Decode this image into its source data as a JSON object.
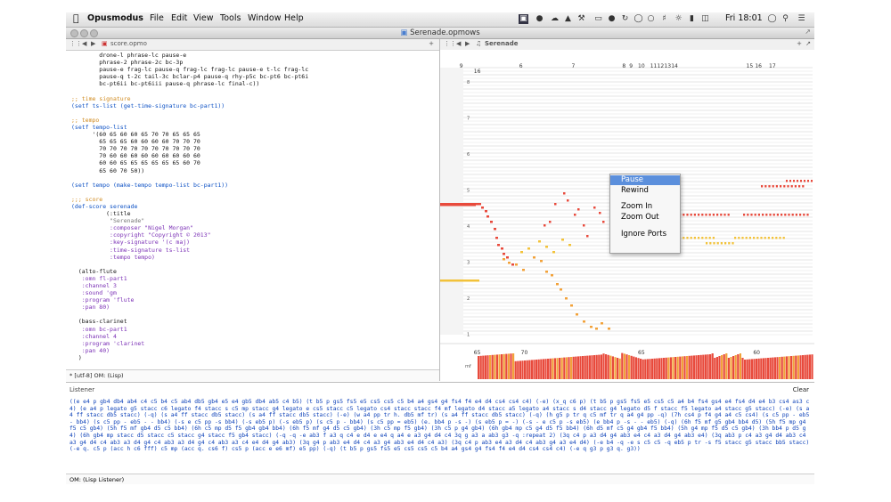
{
  "menubar": {
    "app_name": "Opusmodus",
    "items": [
      "File",
      "Edit",
      "View",
      "Tools",
      "Window",
      "Help"
    ],
    "clock": "Fri 18:01"
  },
  "window": {
    "title": "Serenade.opmows"
  },
  "editor": {
    "tab_title": "score.opmo",
    "code_lines": [
      "        drone-l phrase-lc pause-e",
      "        phrase-2 phrase-2c bc-3p",
      "        pause-e frag-lc pause-q frag-lc frag-lc pause-e t-lc frag-lc",
      "        pause-q t-2c tail-3c bclar-p4 pause-q rhy-p5c bc-pt6 bc-pt6i",
      "        bc-pt6ii bc-pt6iii pause-q phrase-lc final-c))",
      "",
      ";; time signature",
      "(setf ts-list (get-time-signature bc-part1))",
      "",
      ";; tempo",
      "(setf tempo-list",
      "      '(60 65 60 60 65 70 70 65 65 65",
      "        65 65 65 60 60 60 60 70 70 70",
      "        70 70 70 70 70 70 70 70 70 70",
      "        70 60 60 60 60 60 60 60 60 60",
      "        60 60 65 65 65 65 65 65 60 70",
      "        65 60 70 50))",
      "",
      "(setf tempo (make-tempo tempo-list bc-part1))",
      "",
      ";;; score",
      "(def-score serenade",
      "          (:title",
      "           \"Serenade\"",
      "           :composer \"Nigel Morgan\"",
      "           :copyright \"Copyright © 2013\"",
      "           :key-signature '(c maj)",
      "           :time-signature ts-list",
      "           :tempo tempo)",
      "",
      "  (alto-flute",
      "   :omn fl-part1",
      "   :channel 3",
      "   :sound 'gm",
      "   :program 'flute",
      "   :pan 80)",
      "",
      "  (bass-clarinet",
      "   :omn bc-part1",
      "   :channel 4",
      "   :program 'clarinet",
      "   :pan 40)",
      "  )"
    ],
    "status": "* [utf-8] OM:  (Lisp)"
  },
  "roll": {
    "tab_title": "Serenade",
    "bar_numbers": [
      {
        "label": "9",
        "beat": 0.03
      },
      {
        "label": "16",
        "beat": 0.03
      },
      {
        "label": "6",
        "beat": 0.16
      },
      {
        "label": "7",
        "beat": 0.31
      },
      {
        "label": "8",
        "beat": 0.455
      },
      {
        "label": "9",
        "beat": 0.475
      },
      {
        "label": "10",
        "beat": 0.5
      },
      {
        "label": "11",
        "beat": 0.535
      },
      {
        "label": "12",
        "beat": 0.555
      },
      {
        "label": "13",
        "beat": 0.575
      },
      {
        "label": "14",
        "beat": 0.595
      },
      {
        "label": "15",
        "beat": 0.81
      },
      {
        "label": "16",
        "beat": 0.835
      },
      {
        "label": "17",
        "beat": 0.875
      }
    ],
    "octave_labels": [
      "8",
      "7",
      "6",
      "5",
      "4",
      "3",
      "2",
      "1"
    ],
    "tempo_labels": [
      {
        "label": "65",
        "beat": 0.03
      },
      {
        "label": "70",
        "beat": 0.165
      },
      {
        "label": "65",
        "beat": 0.5
      },
      {
        "label": "60",
        "beat": 0.83
      }
    ],
    "velocity_label": "mf"
  },
  "context_menu": {
    "items": [
      "Pause",
      "Rewind",
      "Zoom In",
      "Zoom Out",
      "Ignore Ports"
    ],
    "highlighted": "Pause"
  },
  "listener": {
    "title": "Listener",
    "clear_label": "Clear",
    "output": "((e e4 p gb4 db4 ab4 c4 c5 b4 c5 ab4 db5 gb4 e5 e4 gb5 db4 ab5 c4 b5) (t b5 p gs5 fs5 e5 cs5 cs5 c5 b4 a4 gs4 g4 fs4 f4 e4 d4 cs4 cs4 c4) (-e) (x_q c6 p) (t b5 p gs5 fs5 e5 cs5 c5 a4 b4 fs4 gs4 e4 fs4 d4 e4 b3 cs4 as3 c4) (e a4 p legato g5 stacc c6 legato f4 stacc s c5 mp stacc g4 legato e cs5 stacc c5 legato cs4 stacc stacc f4 mf legato d4 stacc a5 legato a4 stacc s d4 stacc g4 legato d5 f stacc f5 legato a4 stacc g5 stacc) (-e) (s a4 ff stacc db5 stacc) (-q) (s a4 ff stacc db5 stacc) (s a4 ff stacc db5 stacc) (-e) (w a4 pp tr h. db5 mf tr) (s a4 ff stacc db5 stacc) (-q) (h g5 p tr q c5 mf tr q a4 g4 pp -q) (7h cs4 p f4 g4 a4 c5 cs4) (s c5 pp - eb5 - bb4) (s c5 pp - eb5 - - bb4) (-s e c5 pp -s bb4) (-s eb5 p) (-s eb5 p) (s c5 p - bb4) (s c5 pp = eb5) (e. bb4 p -s -) (s eb5 p = -) (-s - e c5 p -s eb5) (e bb4 p -s - - eb5) (-q) (6h f5 mf g5 gb4 bb4 d5) (5h f5 mp g4 f5 c5 gb4) (5h f5 mf gb4 d5 c5 bb4) (6h c5 mp d5 f5 gb4 gb4 bb4) (6h f5 mf g4 d5 c5 gb4) (3h c5 mp f5 gb4) (3h c5 p g4 gb4) (6h gb4 mp c5 g4 d5 f5 bb4) (6h d5 mf c5 g4 gb4 f5 bb4) (5h g4 mp f5 d5 c5 gb4) (3h bb4 p d5 g4) (6h gb4 mp stacc d5 stacc c5 stacc g4 stacc f5 gb4 stacc) (-q -q -e ab3 f a3 q c4 e d4 e e4 q a4 e a3 g4 d4 c4 3q g a3 a ab3 g3 -q :repeat 2) (3q c4 p a3 d4 g4 ab3 e4 c4 a3 d4 g4 ab3 e4) (3q ab3 p c4 a3 g4 d4 ab3 c4 a3 g4 d4 c4 ab3 a3 d4 g4 c4 ab3 a3 d4 g4 c4 ab3 a3 c4 e4 d4 g4 ab3) (3q g4 p ab3 e4 d4 c4 a3 g4 ab3 e4 d4 c4 a3) (3q c4 p ab3 e4 a3 d4 c4 ab3 g4 a3 e4 d4) (-e b4 -q -e s c5 c5 -q eb5 p tr -s f5 stacc g5 stacc bb5 stacc) (-e q. c5 p (acc h c6 fff) c5 mp (acc q. cs6 f) cs5 p (acc e e6 mf) e5 pp) (-q) (t b5 p gs5 fs5 e5 cs5 cs5 c5 b4 a4 gs4 g4 fs4 f4 e4 d4 cs4 cs4 c4) (-e q g3 p g3 q. g3))",
    "status": "OM:  (Lisp Listener)"
  },
  "colors": {
    "accent": "#5b8fdc",
    "note_red": "#e84a3c",
    "note_orange": "#f2a23a",
    "note_yellow": "#f2c23a"
  }
}
